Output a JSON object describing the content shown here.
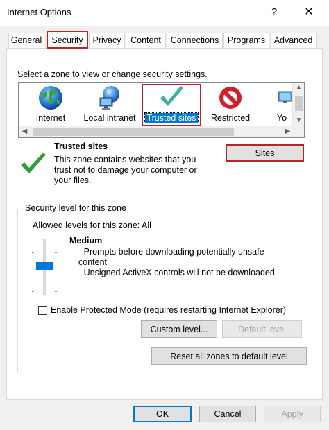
{
  "window": {
    "title": "Internet Options",
    "help_glyph": "?",
    "close_glyph": "✕"
  },
  "tabs": [
    {
      "label": "General"
    },
    {
      "label": "Security"
    },
    {
      "label": "Privacy"
    },
    {
      "label": "Content"
    },
    {
      "label": "Connections"
    },
    {
      "label": "Programs"
    },
    {
      "label": "Advanced"
    }
  ],
  "active_tab": "Security",
  "security": {
    "prompt": "Select a zone to view or change security settings.",
    "zones": [
      {
        "label": "Internet",
        "icon": "globe-icon"
      },
      {
        "label": "Local intranet",
        "icon": "intranet-icon"
      },
      {
        "label": "Trusted sites",
        "icon": "checkmark-icon"
      },
      {
        "label": "Restricted",
        "icon": "restricted-icon"
      },
      {
        "label": "Yo",
        "icon": "computer-icon"
      }
    ],
    "selected_zone": "Trusted sites",
    "zone_title": "Trusted sites",
    "zone_description": "This zone contains websites that you trust not to damage your computer or your files.",
    "sites_button": "Sites",
    "group_label": "Security level for this zone",
    "allowed_levels": "Allowed levels for this zone: All",
    "level_name": "Medium",
    "level_details": [
      "- Prompts before downloading potentially unsafe",
      "content",
      "- Unsigned ActiveX controls will not be downloaded"
    ],
    "slider_level_index": 2,
    "slider_levels": 5,
    "protected_mode_label": "Enable Protected Mode (requires restarting Internet Explorer)",
    "protected_mode_checked": false,
    "custom_level_button": "Custom level...",
    "default_level_button": "Default level",
    "reset_button": "Reset all zones to default level"
  },
  "footer": {
    "ok": "OK",
    "cancel": "Cancel",
    "apply": "Apply"
  },
  "colors": {
    "accent": "#0078d7",
    "highlight_box": "#c0202a",
    "check_green": "#2e9e3a",
    "disabled_text": "#a0a0a0"
  }
}
